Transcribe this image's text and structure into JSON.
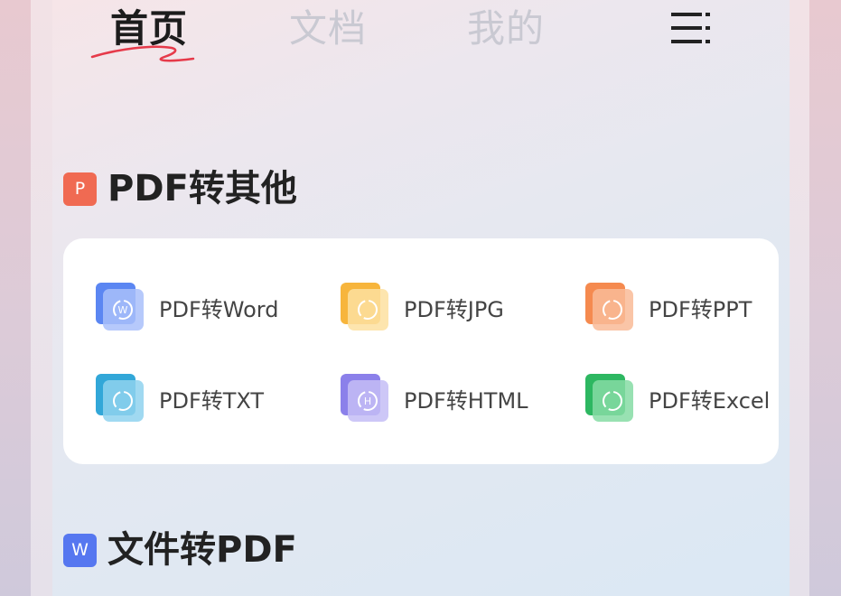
{
  "nav": {
    "tabs": [
      {
        "label": "首页",
        "active": true
      },
      {
        "label": "文档",
        "active": false
      },
      {
        "label": "我的",
        "active": false
      }
    ],
    "menu_icon": "hamburger-menu-icon"
  },
  "sections": [
    {
      "badge": "P",
      "badge_color": "#f06a52",
      "title": "PDF转其他",
      "tools": [
        {
          "label": "PDF转Word",
          "color": "#5b86f2",
          "glyph": "W"
        },
        {
          "label": "PDF转JPG",
          "color": "#f7b53c",
          "glyph": ""
        },
        {
          "label": "PDF转PPT",
          "color": "#f58a4f",
          "glyph": ""
        },
        {
          "label": "PDF转TXT",
          "color": "#32a7d8",
          "glyph": ""
        },
        {
          "label": "PDF转HTML",
          "color": "#8b80ea",
          "glyph": "H"
        },
        {
          "label": "PDF转Excel",
          "color": "#2db761",
          "glyph": ""
        }
      ]
    },
    {
      "badge": "W",
      "badge_color": "#5677f0",
      "title": "文件转PDF"
    }
  ]
}
